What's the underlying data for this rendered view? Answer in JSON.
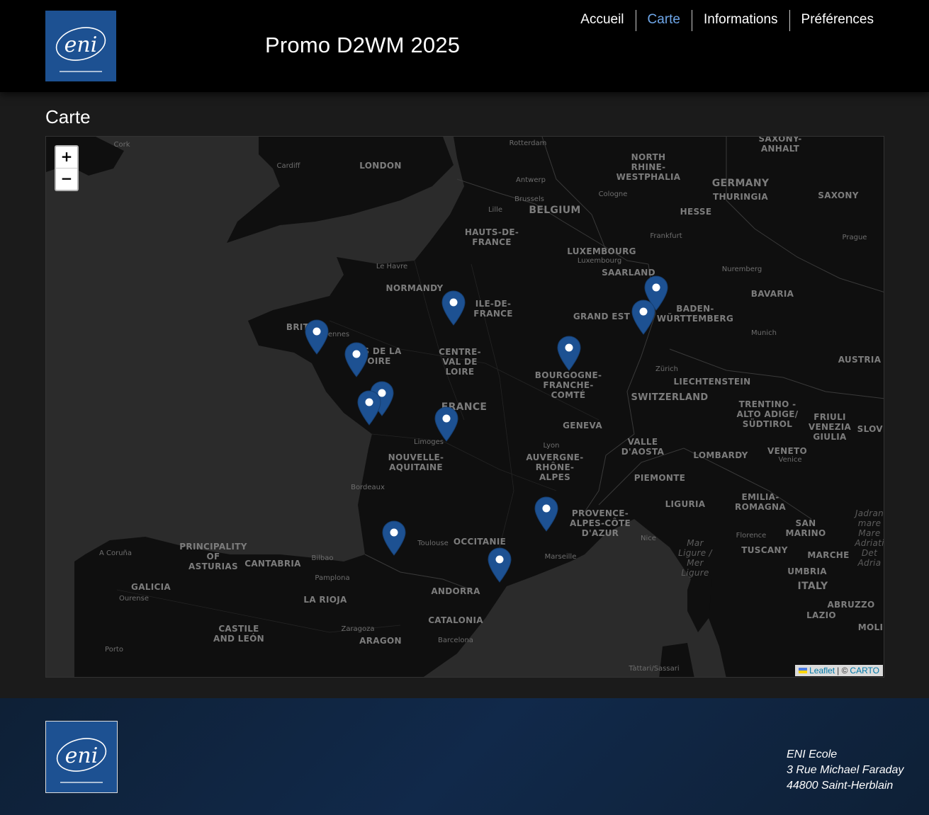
{
  "header": {
    "logo_text": "eni",
    "site_title": "Promo D2WM 2025",
    "nav": [
      {
        "label": "Accueil",
        "active": false
      },
      {
        "label": "Carte",
        "active": true
      },
      {
        "label": "Informations",
        "active": false
      },
      {
        "label": "Préférences",
        "active": false
      }
    ]
  },
  "main": {
    "heading": "Carte"
  },
  "map": {
    "zoom_in": "+",
    "zoom_out": "−",
    "marker_color": "#1d5192",
    "attribution": {
      "leaflet": "Leaflet",
      "separator": "| ©",
      "carto": "CARTO"
    },
    "labels": {
      "cork": "Cork",
      "cardiff": "Cardiff",
      "london": "LONDON",
      "rotterdam": "Rotterdam",
      "antwerp": "Antwerp",
      "brussels": "Brussels",
      "lille": "Lille",
      "belgium": "BELGIUM",
      "north_rhine": "NORTH\nRHINE-\nWESTPHALIA",
      "cologne": "Cologne",
      "germany": "GERMANY",
      "thuringia": "THURINGIA",
      "saxony_anhalt": "SAXONY-\nANHALT",
      "saxony": "SAXONY",
      "hesse": "HESSE",
      "frankfurt": "Frankfurt",
      "prague": "Prague",
      "hauts_de_france": "HAUTS-DE-\nFRANCE",
      "luxembourg": "LUXEMBOURG",
      "luxembourg_city": "Luxembourg",
      "saarland": "SAARLAND",
      "nuremberg": "Nuremberg",
      "le_havre": "Le Havre",
      "normandy": "NORMANDY",
      "ile_de_france": "ILE-DE-\nFRANCE",
      "grand_est": "GRAND EST",
      "baden": "BADEN-\nWÜRTTEMBERG",
      "bavaria": "BAVARIA",
      "munich": "Munich",
      "brittany": "BRIT",
      "rennes": "ennes",
      "pays_de_la_loire": "YS DE LA\nOIRE",
      "centre": "CENTRE-\nVAL DE\nLOIRE",
      "bourgogne": "BOURGOGNE-\nFRANCHE-\nCOMTÉ",
      "zurich": "Zürich",
      "liechtenstein": "LIECHTENSTEIN",
      "austria": "AUSTRIA",
      "switzerland": "SWITZERLAND",
      "france": "FRANCE",
      "geneva": "GENEVA",
      "trentino": "TRENTINO -\nALTO ADIGE/\nSÜDTIROL",
      "friuli": "FRIULI\nVENEZIA\nGIULIA",
      "slovenia": "SLOVE",
      "limoges": "Limoges",
      "nouvelle_aquitaine": "NOUVELLE-\nAQUITAINE",
      "lyon": "Lyon",
      "auvergne": "AUVERGNE-\nRHÔNE-\nALPES",
      "valle": "VALLE\nD'AOSTA",
      "lombardy": "LOMBARDY",
      "veneto": "VENETO",
      "venice": "Venice",
      "piemonte": "PIEMONTE",
      "bordeaux": "Bordeaux",
      "emilia": "EMILIA-\nROMAGNA",
      "liguria": "LIGURIA",
      "provence": "PROVENCE-\nALPES-CÔTE\nD'AZUR",
      "nice": "Nice",
      "mar_ligure": "Mar\nLigure /\nMer\nLigure",
      "florence": "Florence",
      "san_marino": "SAN\nMARINO",
      "adriatic": "Jadran\nmare\nMare\nAdriati\nDet\nAdria",
      "a_coruna": "A Coruña",
      "asturias": "PRINCIPALITY\nOF\nASTURIAS",
      "cantabria": "CANTABRIA",
      "bilbao": "Bilbao",
      "toulouse": "Toulouse",
      "occitanie": "OCCITANIE",
      "marseille": "Marseille",
      "tuscany": "TUSCANY",
      "marche": "MARCHE",
      "umbria": "UMBRIA",
      "galicia": "GALICIA",
      "ourense": "Ourense",
      "pamplona": "Pamplona",
      "andorra": "ANDORRA",
      "italy": "ITALY",
      "abruzzo": "ABRUZZO",
      "la_rioja": "LA RIOJA",
      "lazio": "LAZIO",
      "castile": "CASTILE\nAND LEÓN",
      "zaragoza": "Zaragoza",
      "catalonia": "CATALONIA",
      "molise": "MOLIS",
      "porto": "Porto",
      "aragon": "ARAGON",
      "barcelona": "Barcelona",
      "sassari": "Tàttari/Sassari"
    }
  },
  "footer": {
    "logo_text": "eni",
    "address": [
      "ENI Ecole",
      "3 Rue Michael Faraday",
      "44800 Saint-Herblain"
    ]
  }
}
